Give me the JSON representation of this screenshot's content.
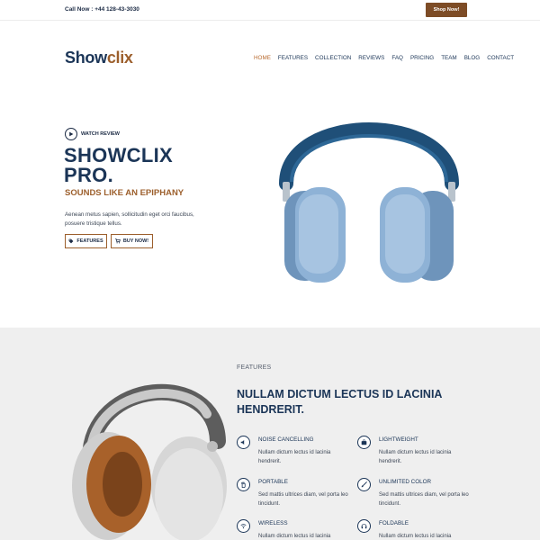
{
  "topbar": {
    "call_text": "Call Now : +44 128-43-3030",
    "shop_button": "Shop Now!"
  },
  "header": {
    "logo_part1": "Show",
    "logo_part2": "clix",
    "nav": [
      "HOME",
      "FEATURES",
      "COLLECTION",
      "REVIEWS",
      "FAQ",
      "PRICING",
      "TEAM",
      "BLOG",
      "CONTACT"
    ],
    "active_nav": "HOME"
  },
  "hero": {
    "watch_label": "WATCH REVIEW",
    "title": "SHOWCLIX PRO.",
    "subtitle": "SOUNDS LIKE AN EPIPHANY",
    "description": "Aenean metus sapien, sollicitudin eget orci faucibus, posuere tristique tellus.",
    "features_button": "FEATURES",
    "buy_button": "BUY NOW!"
  },
  "features": {
    "kicker": "FEATURES",
    "title": "NULLAM DICTUM LECTUS ID LACINIA HENDRERIT.",
    "items": [
      {
        "name": "NOISE CANCELLING",
        "desc": "Nullam dictum lectus id lacinia hendrerit.",
        "icon": "speaker-icon"
      },
      {
        "name": "LIGHTWEIGHT",
        "desc": "Nullam dictum lectus id lacinia hendrerit.",
        "icon": "weight-icon"
      },
      {
        "name": "PORTABLE",
        "desc": "Sed mattis ultrices diam, vel porta leo tincidunt.",
        "icon": "hand-icon"
      },
      {
        "name": "UNLIMITED COLOR",
        "desc": "Sed mattis ultrices diam, vel porta leo tincidunt.",
        "icon": "brush-icon"
      },
      {
        "name": "WIRELESS",
        "desc": "Nullam dictum lectus id lacinia",
        "icon": "wifi-icon"
      },
      {
        "name": "FOLDABLE",
        "desc": "Nullam dictum lectus id lacinia",
        "icon": "headphones-icon"
      }
    ]
  },
  "colors": {
    "navy": "#1b3557",
    "brown": "#9c5f2c",
    "shop_button_bg": "#7d4c26",
    "features_bg": "#efefef"
  }
}
